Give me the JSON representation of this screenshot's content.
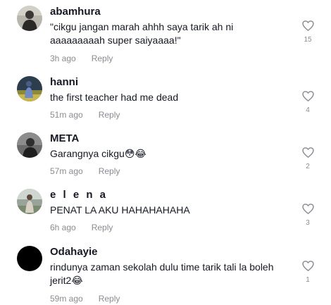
{
  "comments": [
    {
      "username": "abamhura",
      "text": "\"cikgu jangan marah ahhh saya tarik ah ni aaaaaaaaah super saiyaaaa!\"",
      "time": "3h ago",
      "reply_label": "Reply",
      "likes": "15",
      "avatar": "avatar-person-dark"
    },
    {
      "username": "hanni",
      "text": "the first teacher had me dead",
      "time": "51m ago",
      "reply_label": "Reply",
      "likes": "4",
      "avatar": "avatar-person-field"
    },
    {
      "username": "META",
      "text": "Garangnya cikgu😳😂",
      "time": "57m ago",
      "reply_label": "Reply",
      "likes": "2",
      "avatar": "avatar-person-gray"
    },
    {
      "username": "e l e n a",
      "text": "PENAT LA AKU HAHAHAHAHA",
      "time": "6h ago",
      "reply_label": "Reply",
      "likes": "3",
      "avatar": "avatar-person-outdoor"
    },
    {
      "username": "Odahayie",
      "text": "rindunya zaman sekolah dulu time tarik tali la boleh jerit2😂",
      "time": "59m ago",
      "reply_label": "Reply",
      "likes": "1",
      "avatar": "avatar-black"
    }
  ],
  "colors": {
    "text": "#161823",
    "secondary": "#8a8b91",
    "icon": "#8a8b91"
  }
}
